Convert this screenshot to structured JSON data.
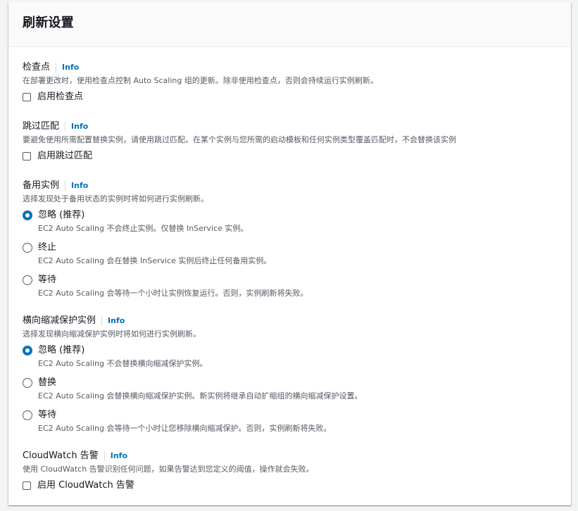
{
  "panel": {
    "title": "刷新设置"
  },
  "checkpoint": {
    "label": "检查点",
    "info": "Info",
    "description": "在部署更改时，使用检查点控制 Auto Scaling 组的更新。除非使用检查点，否则会持续运行实例刷新。",
    "checkbox_label": "启用检查点"
  },
  "skip_matching": {
    "label": "跳过匹配",
    "info": "Info",
    "description": "要避免使用所需配置替换实例，请使用跳过匹配。在某个实例与您所需的启动模板和任何实例类型覆盖匹配时，不会替换该实例",
    "checkbox_label": "启用跳过匹配"
  },
  "standby": {
    "label": "备用实例",
    "info": "Info",
    "description": "选择发现处于备用状态的实例时将如何进行实例刷新。",
    "options": [
      {
        "label": "忽略 (推荐)",
        "description": "EC2 Auto Scaling 不会终止实例。仅替换 InService 实例。",
        "checked": true
      },
      {
        "label": "终止",
        "description": "EC2 Auto Scaling 会在替换 InService 实例后终止任何备用实例。",
        "checked": false
      },
      {
        "label": "等待",
        "description": "EC2 Auto Scaling 会等待一个小时让实例恢复运行。否则，实例刷新将失败。",
        "checked": false
      }
    ]
  },
  "scale_in": {
    "label": "横向缩减保护实例",
    "info": "Info",
    "description": "选择发现横向缩减保护实例时将如何进行实例刷新。",
    "options": [
      {
        "label": "忽略 (推荐)",
        "description": "EC2 Auto Scaling 不会替换横向缩减保护实例。",
        "checked": true
      },
      {
        "label": "替换",
        "description": "EC2 Auto Scaling 会替换横向缩减保护实例。新实例将继承自动扩缩组的横向缩减保护设置。",
        "checked": false
      },
      {
        "label": "等待",
        "description": "EC2 Auto Scaling 会等待一个小时让您移除横向缩减保护。否则，实例刷新将失败。",
        "checked": false
      }
    ]
  },
  "cloudwatch": {
    "label": "CloudWatch 告警",
    "info": "Info",
    "description": "使用 CloudWatch 告警识别任何问题，如果告警达到您定义的阈值，操作就会失败。",
    "checkbox_label": "启用 CloudWatch 告警"
  },
  "colors": {
    "accent": "#0073bb",
    "text": "#16191f",
    "muted": "#545b64",
    "border": "#eaeded"
  }
}
